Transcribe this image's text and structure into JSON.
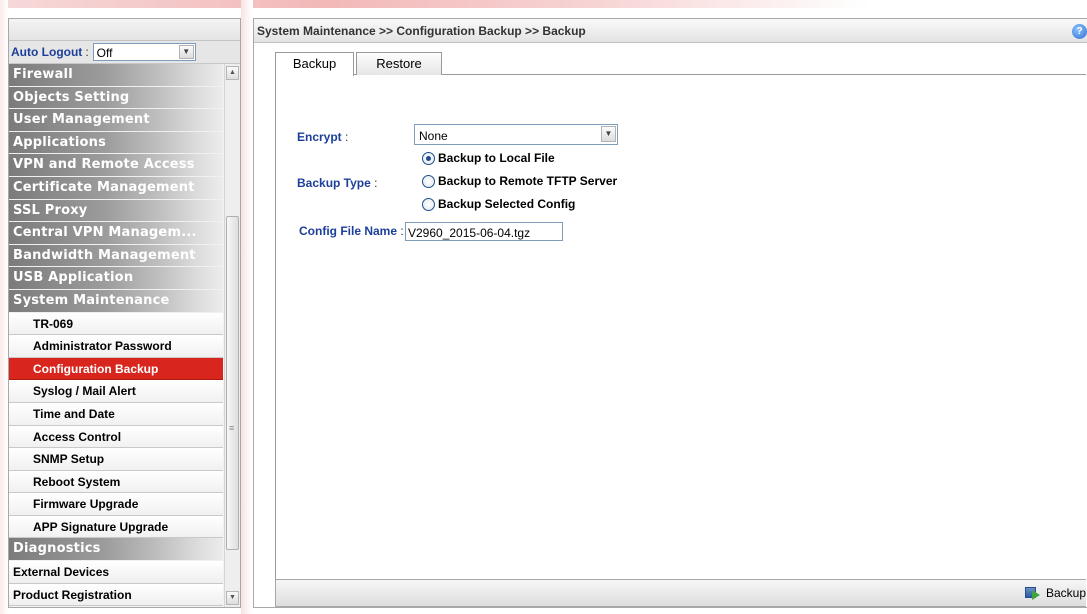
{
  "sidebar": {
    "auto_logout": {
      "label": "Auto Logout",
      "colon": ":",
      "value": "Off"
    },
    "items": [
      {
        "type": "category",
        "label": "Firewall"
      },
      {
        "type": "category",
        "label": "Objects Setting"
      },
      {
        "type": "category",
        "label": "User Management"
      },
      {
        "type": "category",
        "label": "Applications"
      },
      {
        "type": "category",
        "label": "VPN and Remote Access"
      },
      {
        "type": "category",
        "label": "Certificate Management"
      },
      {
        "type": "category",
        "label": "SSL Proxy"
      },
      {
        "type": "category",
        "label": "Central VPN Managem..."
      },
      {
        "type": "category",
        "label": "Bandwidth Management"
      },
      {
        "type": "category",
        "label": "USB Application"
      },
      {
        "type": "category",
        "label": "System Maintenance"
      },
      {
        "type": "sub",
        "label": "TR-069"
      },
      {
        "type": "sub",
        "label": "Administrator Password"
      },
      {
        "type": "sub",
        "label": "Configuration Backup",
        "active": true
      },
      {
        "type": "sub",
        "label": "Syslog / Mail Alert"
      },
      {
        "type": "sub",
        "label": "Time and Date"
      },
      {
        "type": "sub",
        "label": "Access Control"
      },
      {
        "type": "sub",
        "label": "SNMP Setup"
      },
      {
        "type": "sub",
        "label": "Reboot System"
      },
      {
        "type": "sub",
        "label": "Firmware Upgrade"
      },
      {
        "type": "sub",
        "label": "APP Signature Upgrade"
      },
      {
        "type": "category",
        "label": "Diagnostics"
      },
      {
        "type": "plain",
        "label": "External Devices"
      },
      {
        "type": "plain",
        "label": "Product Registration"
      }
    ]
  },
  "main": {
    "breadcrumb": "System Maintenance >> Configuration Backup >> Backup",
    "help_icon": "?",
    "tabs": [
      {
        "label": "Backup",
        "active": true
      },
      {
        "label": "Restore",
        "active": false
      }
    ],
    "form": {
      "encrypt": {
        "label": "Encrypt",
        "colon": ":",
        "value": "None"
      },
      "backup_type": {
        "label": "Backup Type",
        "colon": ":",
        "options": [
          {
            "label": "Backup to Local File",
            "checked": true
          },
          {
            "label": "Backup to Remote TFTP Server",
            "checked": false
          },
          {
            "label": "Backup Selected Config",
            "checked": false
          }
        ]
      },
      "config_file_name": {
        "label": "Config File Name",
        "colon": ":",
        "value": "V2960_2015-06-04.tgz"
      }
    },
    "backup_button": "Backup"
  },
  "icons": {
    "help": "help-icon",
    "dropdown": "chevron-down-icon",
    "backup": "backup-icon"
  },
  "colors": {
    "active_menu": "#d8251d",
    "label_blue": "#1d3f99"
  }
}
